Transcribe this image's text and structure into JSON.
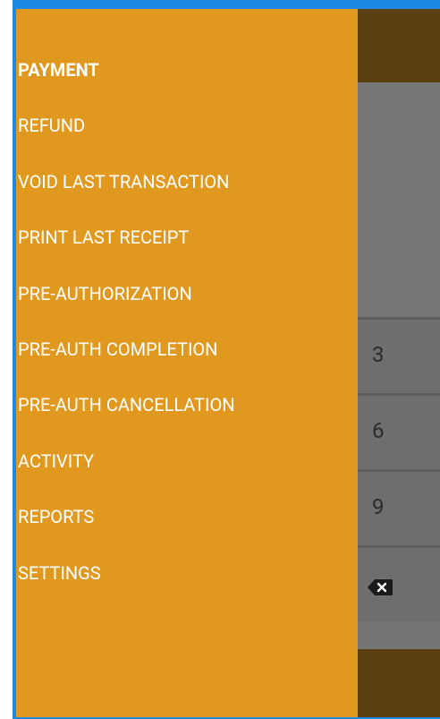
{
  "drawer": {
    "items": [
      {
        "label": "PAYMENT",
        "active": true
      },
      {
        "label": "REFUND",
        "active": false
      },
      {
        "label": "VOID LAST TRANSACTION",
        "active": false
      },
      {
        "label": "PRINT LAST RECEIPT",
        "active": false
      },
      {
        "label": "PRE-AUTHORIZATION",
        "active": false
      },
      {
        "label": "PRE-AUTH COMPLETION",
        "active": false
      },
      {
        "label": "PRE-AUTH CANCELLATION",
        "active": false
      },
      {
        "label": "ACTIVITY",
        "active": false
      },
      {
        "label": "REPORTS",
        "active": false
      },
      {
        "label": "SETTINGS",
        "active": false
      }
    ]
  },
  "keypad": {
    "keys": [
      "3",
      "6",
      "9"
    ],
    "backspace_icon": "backspace-icon"
  },
  "colors": {
    "drawer_background": "#e0981f",
    "header_background": "#5c4012",
    "scrim": "#757575",
    "frame": "#1e88e5"
  }
}
